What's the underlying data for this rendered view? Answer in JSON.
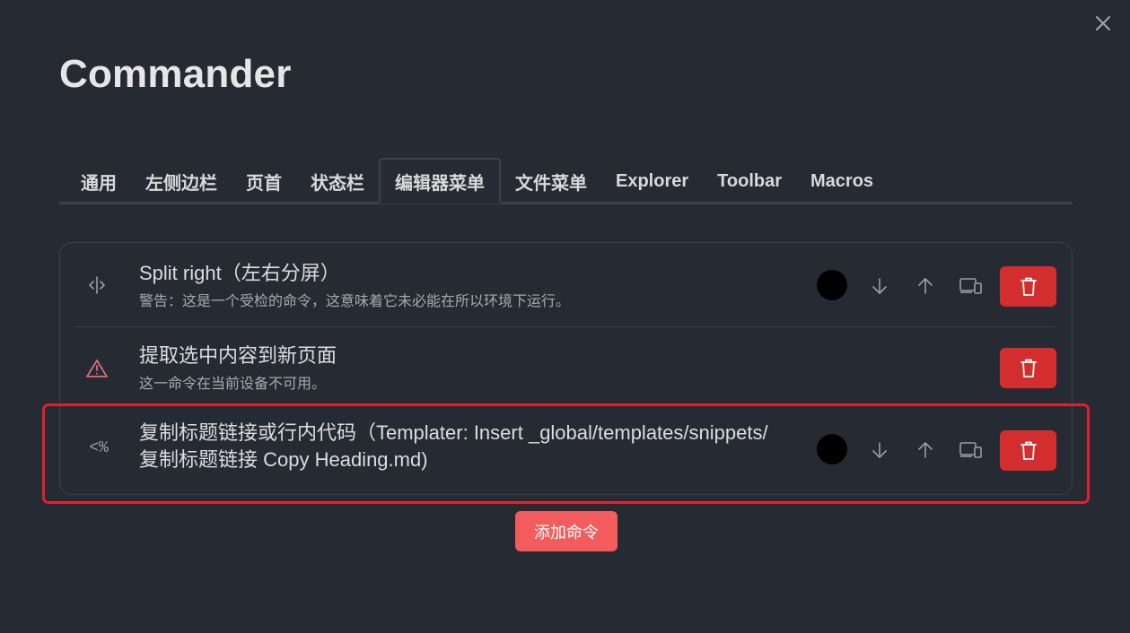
{
  "title": "Commander",
  "tabs": [
    {
      "label": "通用"
    },
    {
      "label": "左侧边栏"
    },
    {
      "label": "页首"
    },
    {
      "label": "状态栏"
    },
    {
      "label": "编辑器菜单",
      "active": true
    },
    {
      "label": "文件菜单"
    },
    {
      "label": "Explorer"
    },
    {
      "label": "Toolbar"
    },
    {
      "label": "Macros"
    }
  ],
  "commands": [
    {
      "icon": "split-horizontal-icon",
      "title": "Split right（左右分屏）",
      "description": "警告：这是一个受检的命令，这意味着它未必能在所以环境下运行。",
      "color": "#000000"
    },
    {
      "icon": "warning-triangle-icon",
      "title": "提取选中内容到新页面",
      "description": "这一命令在当前设备不可用。"
    },
    {
      "icon": "templater-icon",
      "icon_text": "<%",
      "title_line1": "复制标题链接或行内代码（Templater: Insert _global/templates/snippets/",
      "title_line2": "复制标题链接 Copy Heading.md)",
      "color": "#000000"
    }
  ],
  "add_button_label": "添加命令",
  "colors": {
    "background": "#262a33",
    "delete": "#d42d2d",
    "add": "#f25c5c",
    "highlight": "#e0202a",
    "warning": "#e06b78"
  }
}
